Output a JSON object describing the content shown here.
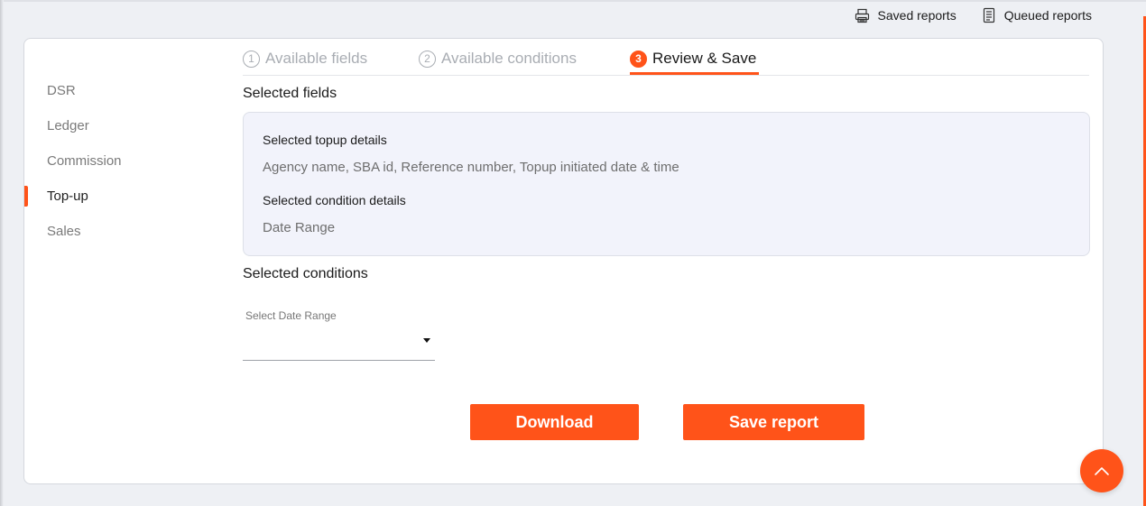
{
  "topbar": {
    "saved_reports": "Saved reports",
    "queued_reports": "Queued reports",
    "saved_icon": "printer-icon",
    "queued_icon": "document-list-icon"
  },
  "sidebar": {
    "items": [
      {
        "label": "DSR",
        "active": false
      },
      {
        "label": "Ledger",
        "active": false
      },
      {
        "label": "Commission",
        "active": false
      },
      {
        "label": "Top-up",
        "active": true
      },
      {
        "label": "Sales",
        "active": false
      }
    ]
  },
  "steps": [
    {
      "number": "1",
      "label": "Available fields",
      "active": false
    },
    {
      "number": "2",
      "label": "Available conditions",
      "active": false
    },
    {
      "number": "3",
      "label": "Review & Save",
      "active": true
    }
  ],
  "selected_fields": {
    "title": "Selected fields",
    "topup_heading": "Selected topup details",
    "topup_values": "Agency name,  SBA id,  Reference number,  Topup initiated date & time",
    "condition_heading": "Selected condition details",
    "condition_values": "Date Range"
  },
  "selected_conditions": {
    "title": "Selected conditions",
    "date_range_label": "Select Date Range",
    "date_range_value": ""
  },
  "actions": {
    "download": "Download",
    "save_report": "Save report"
  },
  "colors": {
    "accent": "#ff5319",
    "panel_bg": "#f2f3fb",
    "page_bg": "#eef0f4"
  }
}
